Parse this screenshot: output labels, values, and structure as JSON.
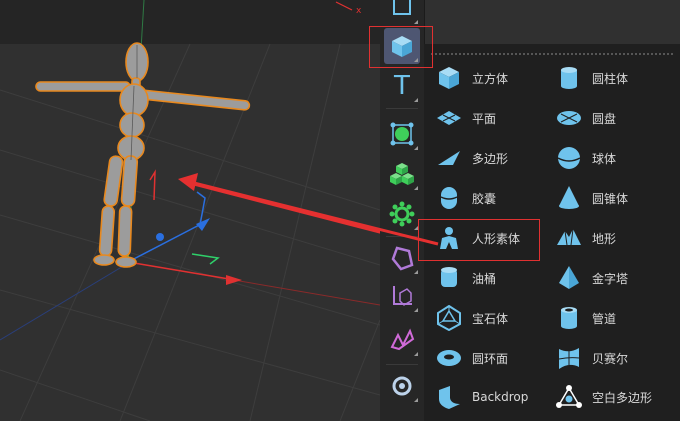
{
  "colors": {
    "viewport_bg": "#303030",
    "toolbar_bg": "#262626",
    "menu_bg": "#1f1f1f",
    "icon_blue": "#6fc3ec",
    "highlight_red": "#e03131",
    "model_outline": "#e8891f",
    "axis_green": "#2fd06a",
    "axis_blue": "#2a6fe0",
    "axis_red": "#e03131"
  },
  "toolbar": {
    "items": [
      {
        "icon": "plane-outline-icon"
      },
      {
        "icon": "cube-icon",
        "active": true
      },
      {
        "icon": "text-icon",
        "label": "T"
      },
      {
        "icon": "generator-icon"
      },
      {
        "icon": "cubes-icon"
      },
      {
        "icon": "gear-cluster-icon"
      },
      {
        "icon": "deformer-icon"
      },
      {
        "icon": "axis-icon"
      },
      {
        "icon": "spline-icon"
      },
      {
        "icon": "light-icon"
      }
    ]
  },
  "menu": {
    "items": [
      {
        "label": "立方体",
        "icon": "cube-icon"
      },
      {
        "label": "圆柱体",
        "icon": "cylinder-icon"
      },
      {
        "label": "平面",
        "icon": "plane-icon"
      },
      {
        "label": "圆盘",
        "icon": "disc-icon"
      },
      {
        "label": "多边形",
        "icon": "polygon-icon"
      },
      {
        "label": "球体",
        "icon": "sphere-icon"
      },
      {
        "label": "胶囊",
        "icon": "capsule-icon"
      },
      {
        "label": "圆锥体",
        "icon": "cone-icon"
      },
      {
        "label": "人形素体",
        "icon": "figure-icon"
      },
      {
        "label": "地形",
        "icon": "landscape-icon"
      },
      {
        "label": "油桶",
        "icon": "oil-tank-icon"
      },
      {
        "label": "金字塔",
        "icon": "pyramid-icon"
      },
      {
        "label": "宝石体",
        "icon": "platonic-icon"
      },
      {
        "label": "管道",
        "icon": "tube-icon"
      },
      {
        "label": "圆环面",
        "icon": "torus-icon"
      },
      {
        "label": "贝赛尔",
        "icon": "bezier-icon"
      },
      {
        "label": "Backdrop",
        "icon": "backdrop-icon"
      },
      {
        "label": "空白多边形",
        "icon": "empty-polygon-icon"
      }
    ]
  }
}
